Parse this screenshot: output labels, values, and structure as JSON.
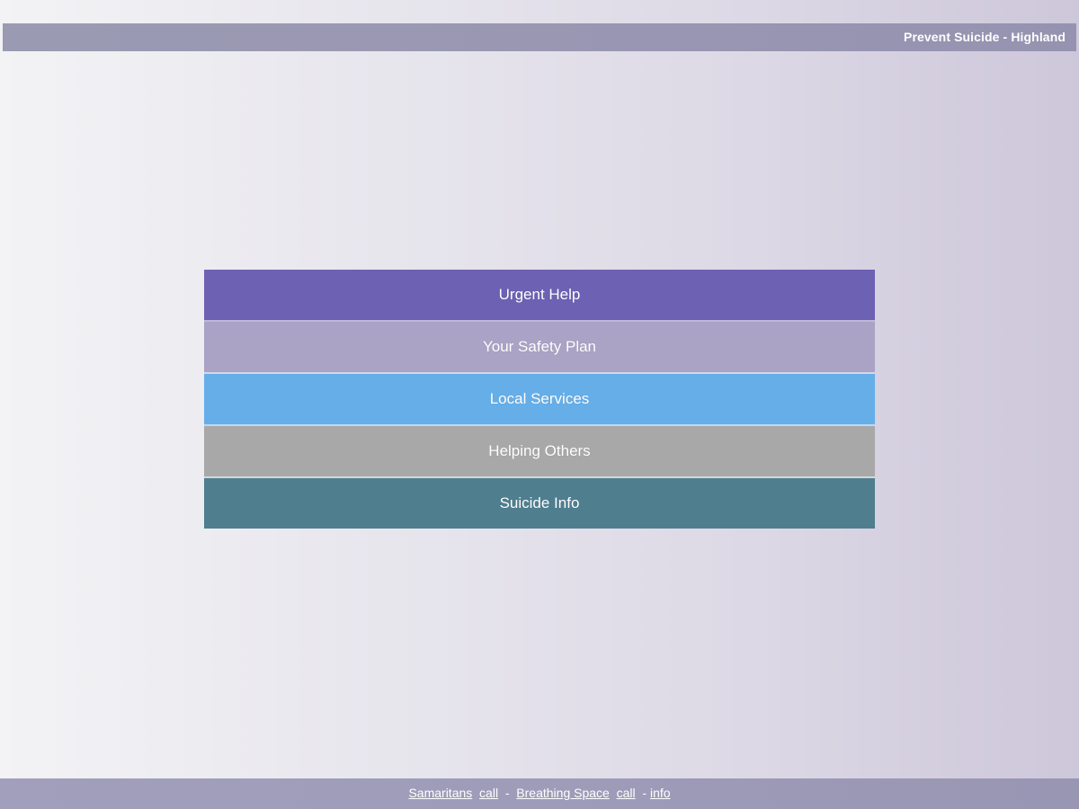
{
  "header": {
    "title": "Prevent Suicide - Highland"
  },
  "menu": {
    "items": [
      {
        "label": "Urgent Help",
        "color": "#6d61b3"
      },
      {
        "label": "Your Safety Plan",
        "color": "#aaa3c6"
      },
      {
        "label": "Local Services",
        "color": "#66aee8"
      },
      {
        "label": "Helping Others",
        "color": "#a8a8a8"
      },
      {
        "label": "Suicide Info",
        "color": "#4f7e8f"
      }
    ]
  },
  "footer": {
    "samaritans": "Samaritans",
    "samaritans_call": "call",
    "sep1": "-",
    "breathing_space": "Breathing Space",
    "breathing_space_call": "call",
    "sep2": "-",
    "info": "info"
  }
}
